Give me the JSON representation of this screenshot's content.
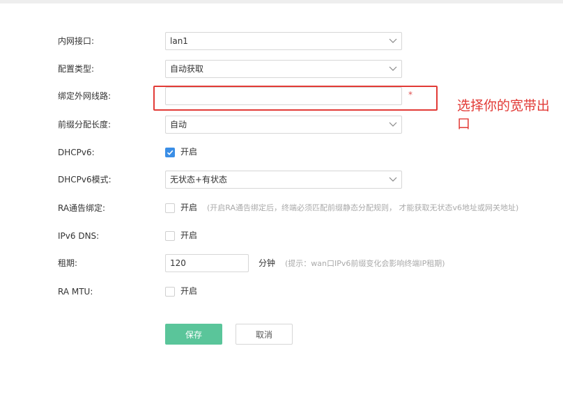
{
  "form": {
    "lan_interface": {
      "label": "内网接口:",
      "value": "lan1"
    },
    "config_type": {
      "label": "配置类型:",
      "value": "自动获取"
    },
    "bind_wan": {
      "label": "绑定外网线路:",
      "value": "",
      "required_mark": "*"
    },
    "prefix_length": {
      "label": "前缀分配长度:",
      "value": "自动"
    },
    "dhcpv6": {
      "label": "DHCPv6:",
      "checkbox_label": "开启",
      "checked": true
    },
    "dhcpv6_mode": {
      "label": "DHCPv6模式:",
      "value": "无状态+有状态"
    },
    "ra_bind": {
      "label": "RA通告绑定:",
      "checkbox_label": "开启",
      "checked": false,
      "hint": "(开启RA通告绑定后，终端必须匹配前缀静态分配规则， 才能获取无状态v6地址或网关地址)"
    },
    "ipv6_dns": {
      "label": "IPv6 DNS:",
      "checkbox_label": "开启",
      "checked": false
    },
    "lease": {
      "label": "租期:",
      "value": "120",
      "unit": "分钟",
      "hint": "(提示：wan口IPv6前缀变化会影响终端IP租期)"
    },
    "ra_mtu": {
      "label": "RA MTU:",
      "checkbox_label": "开启",
      "checked": false
    }
  },
  "buttons": {
    "save": "保存",
    "cancel": "取消"
  },
  "annotation": {
    "text": "选择你的宽带出口",
    "color": "#e23a36"
  },
  "colors": {
    "primary": "#5ac59a",
    "checkbox": "#3a8ee6",
    "required": "#e05050"
  },
  "icons": {
    "select_arrow": "chevron-down-icon",
    "checkmark": "checkmark-icon"
  }
}
